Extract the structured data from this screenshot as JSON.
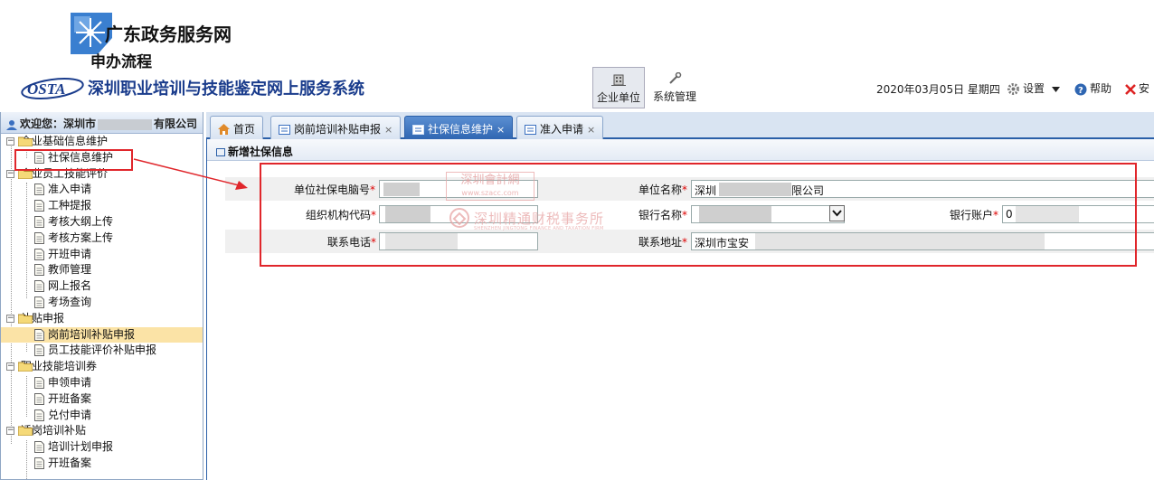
{
  "header": {
    "portal_title": "广东政务服务网",
    "flow_title": "申办流程",
    "osta_logo_text": "OSTA",
    "system_title": "深圳职业培训与技能鉴定网上服务系统",
    "nav_company": "企业单位",
    "nav_system": "系统管理",
    "datetime": "2020年03月05日 星期四",
    "settings": "设置",
    "help": "帮助",
    "exit": "安"
  },
  "sidebar": {
    "welcome_prefix": "欢迎您：深圳市",
    "welcome_suffix": "有限公司",
    "tree": [
      {
        "type": "group",
        "label": "企业基础信息维护"
      },
      {
        "type": "leaf",
        "label": "社保信息维护"
      },
      {
        "type": "group",
        "label": "企业员工技能评价"
      },
      {
        "type": "leaf",
        "label": "准入申请"
      },
      {
        "type": "leaf",
        "label": "工种提报"
      },
      {
        "type": "leaf",
        "label": "考核大纲上传"
      },
      {
        "type": "leaf",
        "label": "考核方案上传"
      },
      {
        "type": "leaf",
        "label": "开班申请"
      },
      {
        "type": "leaf",
        "label": "教师管理"
      },
      {
        "type": "leaf",
        "label": "网上报名"
      },
      {
        "type": "leaf",
        "label": "考场查询"
      },
      {
        "type": "group",
        "label": "补贴申报"
      },
      {
        "type": "leaf",
        "label": "岗前培训补贴申报",
        "active": true
      },
      {
        "type": "leaf",
        "label": "员工技能评价补贴申报"
      },
      {
        "type": "group",
        "label": "职业技能培训券"
      },
      {
        "type": "leaf",
        "label": "申领申请"
      },
      {
        "type": "leaf",
        "label": "开班备案"
      },
      {
        "type": "leaf",
        "label": "兑付申请"
      },
      {
        "type": "group",
        "label": "适岗培训补贴"
      },
      {
        "type": "leaf",
        "label": "培训计划申报"
      },
      {
        "type": "leaf",
        "label": "开班备案"
      }
    ]
  },
  "tabs": [
    {
      "label": "首页",
      "closable": false
    },
    {
      "label": "岗前培训补贴申报",
      "closable": true
    },
    {
      "label": "社保信息维护",
      "closable": true,
      "active": true
    },
    {
      "label": "准入申请",
      "closable": true
    }
  ],
  "tab_close_glyph": "×",
  "panel": {
    "title": "新增社保信息",
    "required_mark": "*",
    "fields": {
      "social_security_no_label": "单位社保电脑号",
      "company_name_label": "单位名称",
      "company_name_value_start": "深圳",
      "company_name_value_end": "限公司",
      "org_code_label": "组织机构代码",
      "bank_name_label": "银行名称",
      "bank_account_label": "银行账户",
      "bank_account_value": "0",
      "phone_label": "联系电话",
      "address_label": "联系地址",
      "address_value": "深圳市宝安"
    }
  },
  "watermarks": {
    "box_main": "深圳會計網",
    "box_url": "www.szacc.com",
    "firm_name": "深圳精通财税事务所",
    "firm_name_en": "SHENZHEN JINGTONG FINANCE AND TAXATION FIRM"
  },
  "colors": {
    "highlight_red": "#e0262b",
    "active_tab_blue": "#2f66b2",
    "active_leaf_bg": "#fbe3a6"
  }
}
